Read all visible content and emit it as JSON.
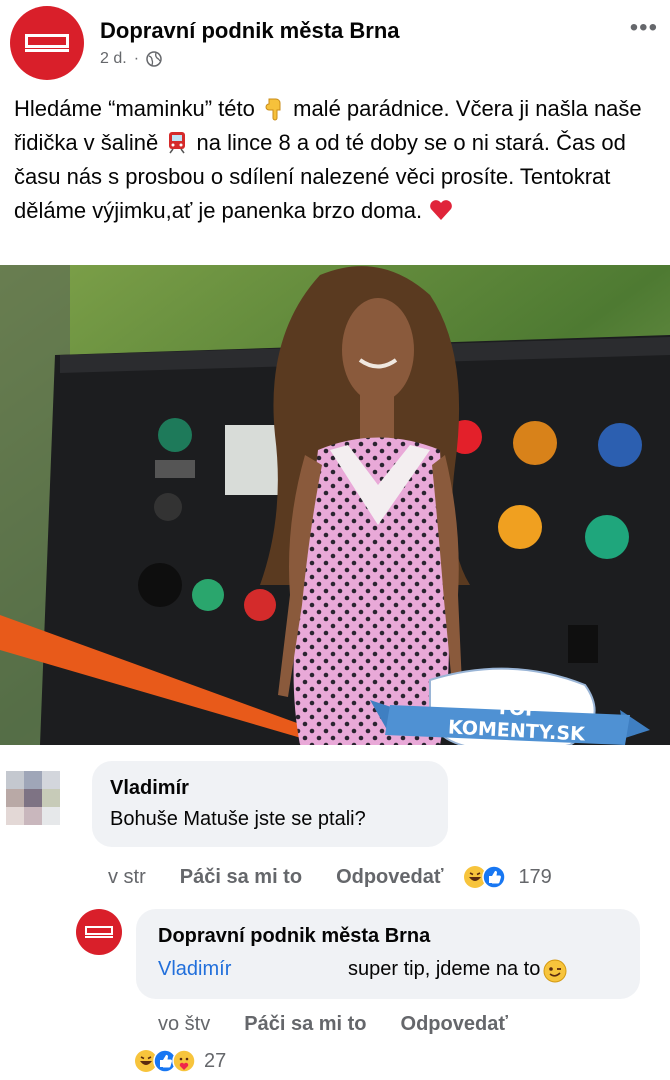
{
  "post": {
    "page_name": "Dopravní podnik města Brna",
    "time": "2 d.",
    "separator": "·",
    "more": "•••",
    "text_1": "Hledáme “maminku” této",
    "text_2": "malé parádnice. Včera ji našla naše řidička v šalině",
    "text_3": "na lince 8 a od té doby se o ni stará. Čas od času nás s prosbou o sdílení nalezené věci prosíte. Tentokrat děláme výjimku,ať je panenka brzo doma.",
    "icons": [
      "hand-pointing-down-icon",
      "tram-icon",
      "heart-icon",
      "globe-icon"
    ]
  },
  "watermark": {
    "text": "TOP KOMENTY.SK"
  },
  "comments": [
    {
      "author": "Vladimír",
      "text": "Bohuše Matuše jste se ptali?",
      "time": "v str",
      "like_label": "Páči sa mi to",
      "reply_label": "Odpovedať",
      "reactions": [
        "laugh-emoji-icon",
        "like-emoji-icon"
      ],
      "reaction_count": "179"
    }
  ],
  "reply": {
    "author": "Dopravní podnik města Brna",
    "mention": "Vladimír",
    "text": "super tip, jdeme na to",
    "time": "vo štv",
    "like_label": "Páči sa mi to",
    "reply_label": "Odpovedať",
    "reactions": [
      "laugh-emoji-icon",
      "like-emoji-icon",
      "care-emoji-icon"
    ],
    "reaction_count": "27"
  },
  "colors": {
    "brand_red": "#d91f2a",
    "link_blue": "#216fdb",
    "muted": "#65676b",
    "bubble": "#f0f2f5"
  }
}
